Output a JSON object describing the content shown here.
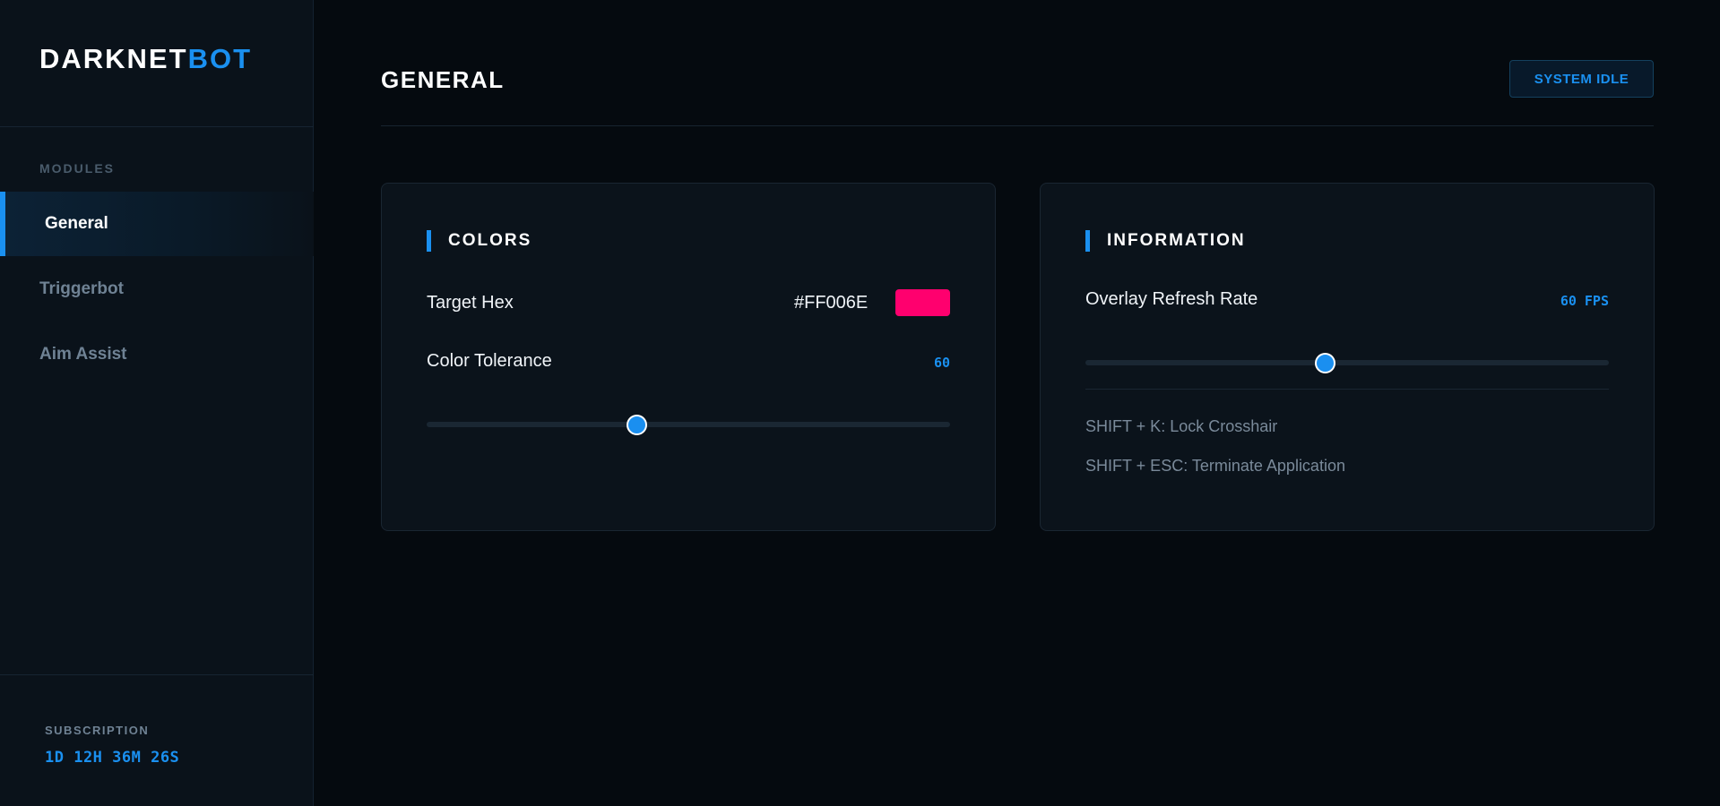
{
  "app": {
    "logo_primary": "DARKNET",
    "logo_accent": "BOT"
  },
  "sidebar": {
    "heading": "MODULES",
    "items": [
      {
        "label": "General",
        "active": true
      },
      {
        "label": "Triggerbot",
        "active": false
      },
      {
        "label": "Aim Assist",
        "active": false
      }
    ],
    "subscription_label": "SUBSCRIPTION",
    "subscription_timer": "1D 12H 36M 26S"
  },
  "header": {
    "title": "GENERAL",
    "status": "SYSTEM IDLE"
  },
  "colors_card": {
    "title": "COLORS",
    "target_hex_label": "Target Hex",
    "target_hex_value": "#FF006E",
    "swatch_color": "#FF006E",
    "tolerance_label": "Color Tolerance",
    "tolerance_value": "60",
    "tolerance_fraction": 0.4
  },
  "info_card": {
    "title": "INFORMATION",
    "refresh_label": "Overlay Refresh Rate",
    "refresh_value": "60 FPS",
    "refresh_fraction": 0.457,
    "hotkeys": [
      "SHIFT + K: Lock Crosshair",
      "SHIFT + ESC: Terminate Application"
    ]
  },
  "theme": {
    "accent": "#1A90F0",
    "background": "#050A0F",
    "panel": "#0B131B"
  }
}
